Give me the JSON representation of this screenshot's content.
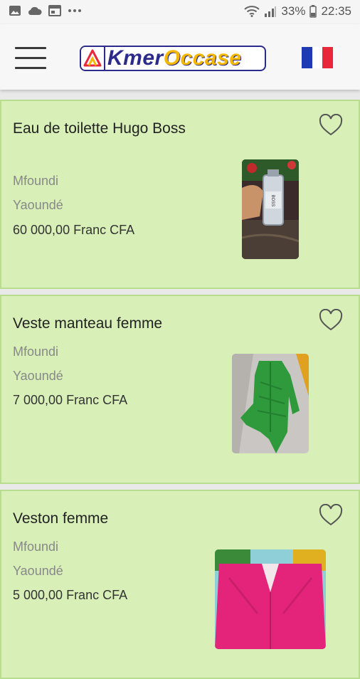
{
  "status_bar": {
    "battery": "33%",
    "time": "22:35"
  },
  "header": {
    "logo_text_kmer": "Kmer",
    "logo_text_occase": "Occase",
    "language": "French",
    "flag_colors": [
      "#1f3bb3",
      "#ffffff",
      "#e8283a"
    ]
  },
  "listings": [
    {
      "title": "Eau de toilette Hugo Boss",
      "district": "Mfoundi",
      "city": "Yaoundé",
      "price": "60 000,00 Franc CFA",
      "favorite_icon": "heart-outline-icon"
    },
    {
      "title": "Veste manteau femme",
      "district": "Mfoundi",
      "city": "Yaoundé",
      "price": "7 000,00 Franc CFA",
      "favorite_icon": "heart-outline-icon"
    },
    {
      "title": "Veston femme",
      "district": "Mfoundi",
      "city": "Yaoundé",
      "price": "5 000,00 Franc CFA",
      "favorite_icon": "heart-outline-icon"
    }
  ],
  "colors": {
    "card_bg": "#d8f0b8",
    "card_border": "#b9dd8e",
    "brand_blue": "#2c2a8a",
    "brand_yellow": "#f5b800"
  }
}
